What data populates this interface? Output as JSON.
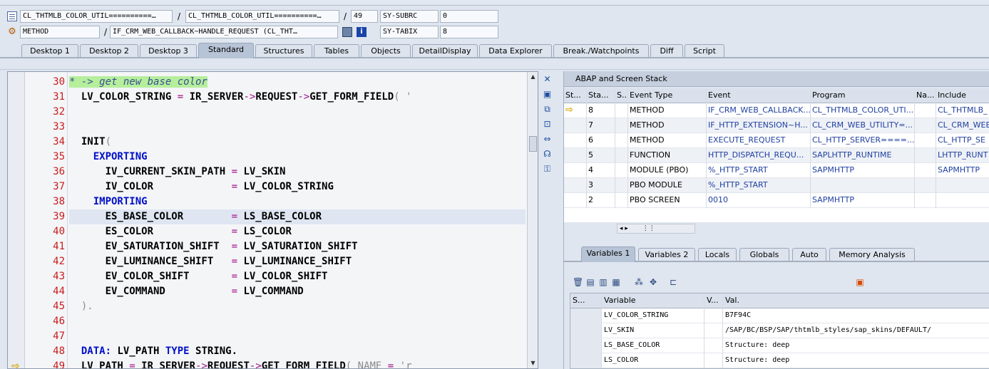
{
  "info": {
    "row1": {
      "field1": "CL_THTMLB_COLOR_UTIL==========…",
      "field2": "CL_THTMLB_COLOR_UTIL==========…",
      "line": "49",
      "sys_label": "SY-SUBRC",
      "sys_value": "0"
    },
    "row2": {
      "type": "METHOD",
      "event": "IF_CRM_WEB_CALLBACK~HANDLE_REQUEST (CL_THT…",
      "sys_label": "SY-TABIX",
      "sys_value": "8"
    },
    "slash": "/"
  },
  "desktop_tabs": [
    "Desktop 1",
    "Desktop 2",
    "Desktop 3",
    "Standard",
    "Structures",
    "Tables",
    "Objects",
    "DetailDisplay",
    "Data Explorer",
    "Break./Watchpoints",
    "Diff",
    "Script"
  ],
  "code": {
    "line_numbers": [
      "30",
      "31",
      "32",
      "33",
      "34",
      "35",
      "36",
      "37",
      "38",
      "39",
      "40",
      "41",
      "42",
      "43",
      "44",
      "45",
      "46",
      "47",
      "48",
      "49"
    ],
    "lines": [
      [
        {
          "t": "* -> get new base color",
          "c": "cm"
        }
      ],
      [
        {
          "t": "  LV_COLOR_STRING ",
          "c": "bold"
        },
        {
          "t": "=",
          "c": "op"
        },
        {
          "t": " IR_SERVER",
          "c": "bold"
        },
        {
          "t": "->",
          "c": "op"
        },
        {
          "t": "REQUEST",
          "c": "bold"
        },
        {
          "t": "->",
          "c": "op"
        },
        {
          "t": "GET_FORM_FIELD",
          "c": "bold"
        },
        {
          "t": "( '",
          "c": "gray"
        }
      ],
      [],
      [],
      [
        {
          "t": "  INIT",
          "c": "bold"
        },
        {
          "t": "(",
          "c": "gray"
        }
      ],
      [
        {
          "t": "    EXPORTING",
          "c": "kw"
        }
      ],
      [
        {
          "t": "      IV_CURRENT_SKIN_PATH ",
          "c": "bold"
        },
        {
          "t": "=",
          "c": "op"
        },
        {
          "t": " LV_SKIN",
          "c": "bold"
        }
      ],
      [
        {
          "t": "      IV_COLOR             ",
          "c": "bold"
        },
        {
          "t": "=",
          "c": "op"
        },
        {
          "t": " LV_COLOR_STRING",
          "c": "bold"
        }
      ],
      [
        {
          "t": "    IMPORTING",
          "c": "kw"
        }
      ],
      [
        {
          "t": "      ES_BASE_COLOR        ",
          "c": "bold"
        },
        {
          "t": "=",
          "c": "op"
        },
        {
          "t": " LS_BASE_COLOR",
          "c": "bold"
        }
      ],
      [
        {
          "t": "      ES_COLOR             ",
          "c": "bold"
        },
        {
          "t": "=",
          "c": "op"
        },
        {
          "t": " LS_COLOR",
          "c": "bold"
        }
      ],
      [
        {
          "t": "      EV_SATURATION_SHIFT  ",
          "c": "bold"
        },
        {
          "t": "=",
          "c": "op"
        },
        {
          "t": " LV_SATURATION_SHIFT",
          "c": "bold"
        }
      ],
      [
        {
          "t": "      EV_LUMINANCE_SHIFT   ",
          "c": "bold"
        },
        {
          "t": "=",
          "c": "op"
        },
        {
          "t": " LV_LUMINANCE_SHIFT",
          "c": "bold"
        }
      ],
      [
        {
          "t": "      EV_COLOR_SHIFT       ",
          "c": "bold"
        },
        {
          "t": "=",
          "c": "op"
        },
        {
          "t": " LV_COLOR_SHIFT",
          "c": "bold"
        }
      ],
      [
        {
          "t": "      EV_COMMAND           ",
          "c": "bold"
        },
        {
          "t": "=",
          "c": "op"
        },
        {
          "t": " LV_COMMAND",
          "c": "bold"
        }
      ],
      [
        {
          "t": "  ).",
          "c": "gray"
        }
      ],
      [],
      [],
      [
        {
          "t": "  DATA: ",
          "c": "kw"
        },
        {
          "t": "LV_PATH ",
          "c": "bold"
        },
        {
          "t": "TYPE ",
          "c": "kw"
        },
        {
          "t": "STRING.",
          "c": "bold"
        }
      ],
      [
        {
          "t": "  LV_PATH ",
          "c": "bold"
        },
        {
          "t": "=",
          "c": "op"
        },
        {
          "t": " IR_SERVER",
          "c": "bold"
        },
        {
          "t": "->",
          "c": "op"
        },
        {
          "t": "REQUEST",
          "c": "bold"
        },
        {
          "t": "->",
          "c": "op"
        },
        {
          "t": "GET_FORM_FIELD",
          "c": "bold"
        },
        {
          "t": "( NAME ",
          "c": "gray"
        },
        {
          "t": "=",
          "c": "op"
        },
        {
          "t": " 'r",
          "c": "gray"
        }
      ]
    ],
    "highlight_line_index": 9,
    "exec_line_index": 19
  },
  "stack": {
    "title": "ABAP and Screen Stack",
    "headers": [
      "St...",
      "Sta...",
      "S...",
      "Event Type",
      "Event",
      "Program",
      "Na...",
      "Include"
    ],
    "rows": [
      [
        "⇨",
        "8",
        "",
        "METHOD",
        "IF_CRM_WEB_CALLBACK...",
        "CL_THTMLB_COLOR_UTI...",
        "",
        "CL_THTMLB_"
      ],
      [
        "",
        "7",
        "",
        "METHOD",
        "IF_HTTP_EXTENSION~H...",
        "CL_CRM_WEB_UTILITY=...",
        "",
        "CL_CRM_WEB"
      ],
      [
        "",
        "6",
        "",
        "METHOD",
        "EXECUTE_REQUEST",
        "CL_HTTP_SERVER====...",
        "",
        "CL_HTTP_SE"
      ],
      [
        "",
        "5",
        "",
        "FUNCTION",
        "HTTP_DISPATCH_REQU...",
        "SAPLHTTP_RUNTIME",
        "",
        "LHTTP_RUNT"
      ],
      [
        "",
        "4",
        "",
        "MODULE (PBO)",
        "%_HTTP_START",
        "SAPMHTTP",
        "",
        "SAPMHTTP"
      ],
      [
        "",
        "3",
        "",
        "PBO MODULE",
        "%_HTTP_START",
        "",
        "",
        ""
      ],
      [
        "",
        "2",
        "",
        "PBO SCREEN",
        "0010",
        "SAPMHTTP",
        "",
        ""
      ]
    ]
  },
  "var_tabs": [
    "Variables 1",
    "Variables 2",
    "Locals",
    "Globals",
    "Auto",
    "Memory Analysis"
  ],
  "vars": {
    "headers": [
      "S...",
      "Variable",
      "V...",
      "Val."
    ],
    "rows": [
      [
        "",
        "LV_COLOR_STRING",
        "",
        "B7F94C"
      ],
      [
        "",
        "LV_SKIN",
        "",
        "/SAP/BC/BSP/SAP/thtmlb_styles/sap_skins/DEFAULT/"
      ],
      [
        "",
        "LS_BASE_COLOR",
        "",
        "Structure: deep"
      ],
      [
        "",
        "LS_COLOR",
        "",
        "Structure: deep"
      ]
    ]
  }
}
